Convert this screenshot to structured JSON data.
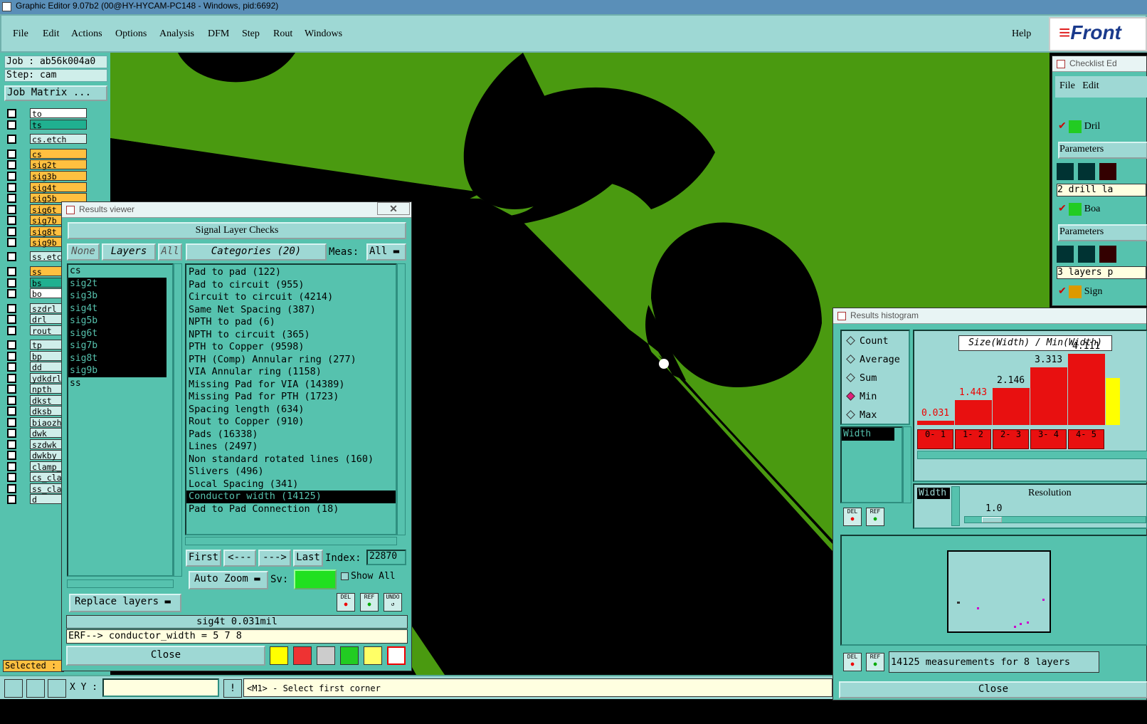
{
  "window_title": "Graphic Editor 9.07b2 (00@HY-HYCAM-PC148 - Windows, pid:6692)",
  "menu": {
    "file": "File",
    "edit": "Edit",
    "actions": "Actions",
    "options": "Options",
    "analysis": "Analysis",
    "dfm": "DFM",
    "step": "Step",
    "rout": "Rout",
    "windows": "Windows",
    "help": "Help"
  },
  "logo_text": "Front",
  "job": {
    "job_label": "Job : ab56k004a0",
    "step_label": "Step: cam",
    "matrix_button": "Job Matrix ..."
  },
  "layers": [
    {
      "name": "to",
      "color": "#ffffff"
    },
    {
      "name": "ts",
      "color": "#20b090"
    },
    {
      "name": "cs.etch",
      "color": "#cfeeea"
    },
    {
      "name": "cs",
      "color": "#ffc040"
    },
    {
      "name": "sig2t",
      "color": "#ffc040"
    },
    {
      "name": "sig3b",
      "color": "#ffc040"
    },
    {
      "name": "sig4t",
      "color": "#ffc040"
    },
    {
      "name": "sig5b",
      "color": "#ffc040"
    },
    {
      "name": "sig6t",
      "color": "#ffc040"
    },
    {
      "name": "sig7b",
      "color": "#ffc040"
    },
    {
      "name": "sig8t",
      "color": "#ffc040"
    },
    {
      "name": "sig9b",
      "color": "#ffc040"
    },
    {
      "name": "ss.etch",
      "color": "#cfeeea"
    },
    {
      "name": "ss",
      "color": "#ffc040"
    },
    {
      "name": "bs",
      "color": "#20b090"
    },
    {
      "name": "bo",
      "color": "#ffffff"
    },
    {
      "name": "szdrl",
      "color": "#cfeeea"
    },
    {
      "name": "drl",
      "color": "#cfeeea"
    },
    {
      "name": "rout",
      "color": "#cfeeea"
    },
    {
      "name": "tp",
      "color": "#cfeeea"
    },
    {
      "name": "bp",
      "color": "#cfeeea"
    },
    {
      "name": "dd",
      "color": "#cfeeea"
    },
    {
      "name": "ydkdrl",
      "color": "#cfeeea"
    },
    {
      "name": "npth",
      "color": "#cfeeea"
    },
    {
      "name": "dkst",
      "color": "#cfeeea"
    },
    {
      "name": "dksb",
      "color": "#cfeeea"
    },
    {
      "name": "biaozh",
      "color": "#cfeeea"
    },
    {
      "name": "dwk",
      "color": "#cfeeea"
    },
    {
      "name": "szdwk",
      "color": "#cfeeea"
    },
    {
      "name": "dwkby",
      "color": "#cfeeea"
    },
    {
      "name": "clamp_",
      "color": "#cfeeea"
    },
    {
      "name": "cs_cla",
      "color": "#cfeeea"
    },
    {
      "name": "ss_cla",
      "color": "#cfeeea"
    },
    {
      "name": "d",
      "color": "#cfeeea"
    }
  ],
  "selected_label": "Selected :",
  "results_viewer": {
    "title": "Results viewer",
    "header": "Signal Layer Checks",
    "none_btn": "None",
    "layers_btn": "Layers",
    "all_btn": "All",
    "categories_btn": "Categories (20)",
    "meas_label": "Meas:",
    "meas_value": "All",
    "layer_list": [
      {
        "name": "cs",
        "sel": false
      },
      {
        "name": "sig2t",
        "sel": true
      },
      {
        "name": "sig3b",
        "sel": true
      },
      {
        "name": "sig4t",
        "sel": true
      },
      {
        "name": "sig5b",
        "sel": true
      },
      {
        "name": "sig6t",
        "sel": true
      },
      {
        "name": "sig7b",
        "sel": true
      },
      {
        "name": "sig8t",
        "sel": true
      },
      {
        "name": "sig9b",
        "sel": true
      },
      {
        "name": "ss",
        "sel": false
      }
    ],
    "categories": [
      {
        "label": "Pad to pad (122)",
        "sel": false
      },
      {
        "label": "Pad to circuit (955)",
        "sel": false
      },
      {
        "label": "Circuit to circuit (4214)",
        "sel": false
      },
      {
        "label": "Same Net Spacing (387)",
        "sel": false
      },
      {
        "label": "NPTH to pad (6)",
        "sel": false
      },
      {
        "label": "NPTH to circuit (365)",
        "sel": false
      },
      {
        "label": "PTH to Copper (9598)",
        "sel": false
      },
      {
        "label": "PTH (Comp) Annular ring (277)",
        "sel": false
      },
      {
        "label": "VIA Annular ring (1158)",
        "sel": false
      },
      {
        "label": "Missing Pad for VIA (14389)",
        "sel": false
      },
      {
        "label": "Missing Pad for PTH (1723)",
        "sel": false
      },
      {
        "label": "Spacing length (634)",
        "sel": false
      },
      {
        "label": "Rout to Copper (910)",
        "sel": false
      },
      {
        "label": "Pads (16338)",
        "sel": false
      },
      {
        "label": "Lines (2497)",
        "sel": false
      },
      {
        "label": "Non standard rotated lines (160)",
        "sel": false
      },
      {
        "label": "Slivers (496)",
        "sel": false
      },
      {
        "label": "Local Spacing (341)",
        "sel": false
      },
      {
        "label": "Conductor width (14125)",
        "sel": true
      },
      {
        "label": "Pad to Pad Connection (18)",
        "sel": false
      }
    ],
    "first_btn": "First",
    "prev_btn": "<---",
    "next_btn": "--->",
    "last_btn": "Last",
    "index_label": "Index:",
    "index_value": "22870",
    "auto_zoom": "Auto Zoom",
    "sv_label": "Sv:",
    "show_all": "Show All",
    "replace_layers": "Replace layers",
    "status_line": "sig4t 0.031mil",
    "erf_line": "ERF--> conductor_width = 5 7 8",
    "close": "Close",
    "del": "DEL",
    "ref": "REF",
    "undo": "UNDO"
  },
  "histogram": {
    "title": "Results histogram",
    "modes": [
      {
        "label": "Count",
        "on": false
      },
      {
        "label": "Average",
        "on": false
      },
      {
        "label": "Sum",
        "on": false
      },
      {
        "label": "Min",
        "on": true
      },
      {
        "label": "Max",
        "on": false
      }
    ],
    "list_item": "Width",
    "chart_title": "Size(Width) / Min(Width)",
    "bars": [
      {
        "value": "0.031",
        "range": "0- 1",
        "v": 0.031
      },
      {
        "value": "1.443",
        "range": "1- 2",
        "v": 1.443
      },
      {
        "value": "2.146",
        "range": "2- 3",
        "v": 2.146
      },
      {
        "value": "3.313",
        "range": "3- 4",
        "v": 3.313
      },
      {
        "value": "4.111",
        "range": "4- 5",
        "v": 4.111
      }
    ],
    "width_label": "Width",
    "resolution_label": "Resolution",
    "resolution_value": "1.0",
    "measurements": "14125 measurements for 8 layers",
    "close": "Close",
    "del": "DEL",
    "ref": "REF"
  },
  "checklist": {
    "title": "Checklist Ed",
    "file": "File",
    "edit": "Edit",
    "item1": "Dril",
    "params1": "Parameters",
    "info1": "2 drill la",
    "item2": "Boa",
    "params2": "Parameters",
    "info2": "3 layers p",
    "item3": "Sign"
  },
  "status": {
    "xy_label": "X Y :",
    "prompt": "<M1> - Select first corner"
  }
}
